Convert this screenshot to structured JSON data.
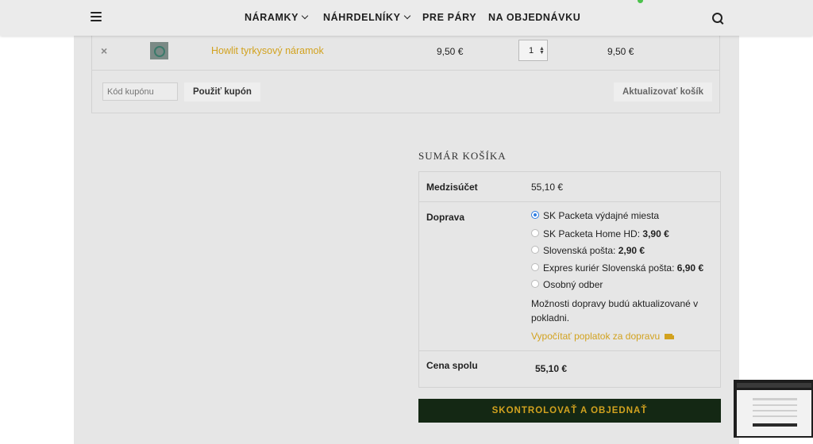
{
  "header": {
    "nav": [
      {
        "label": "NÁRAMKY",
        "dropdown": true
      },
      {
        "label": "NÁHRDELNÍKY",
        "dropdown": true
      },
      {
        "label": "PRE PÁRY",
        "dropdown": false
      },
      {
        "label": "NA OBJEDNÁVKU",
        "dropdown": false
      }
    ]
  },
  "cart": {
    "item": {
      "remove": "×",
      "name": "Howlit tyrkysový náramok",
      "price": "9,50 €",
      "quantity": "1",
      "subtotal": "9,50 €"
    },
    "coupon_placeholder": "Kód kupónu",
    "apply_coupon": "Použiť kupón",
    "update_cart": "Aktualizovať košík"
  },
  "totals": {
    "title": "SUMÁR KOŠÍKA",
    "subtotal_label": "Medzisúčet",
    "subtotal_value": "55,10 €",
    "shipping_label": "Doprava",
    "shipping_options": [
      {
        "label": "SK Packeta výdajné miesta",
        "price": "",
        "checked": true
      },
      {
        "label": "SK Packeta Home HD: ",
        "price": "3,90 €",
        "checked": false
      },
      {
        "label": "Slovenská pošta: ",
        "price": "2,90 €",
        "checked": false
      },
      {
        "label": "Expres kuriér Slovenská pošta: ",
        "price": "6,90 €",
        "checked": false
      },
      {
        "label": "Osobný odber",
        "price": "",
        "checked": false
      }
    ],
    "shipping_note": "Možnosti dopravy budú aktualizované v pokladni.",
    "calc_shipping": "Vypočítať poplatok za dopravu",
    "total_label": "Cena spolu",
    "total_value": "55,10 €"
  },
  "checkout": {
    "label": "SKONTROLOVAŤ A OBJEDNAŤ"
  },
  "colors": {
    "accent": "#d2a21f",
    "checkout_bg": "#142814",
    "page_bg": "#e6e6e6"
  }
}
